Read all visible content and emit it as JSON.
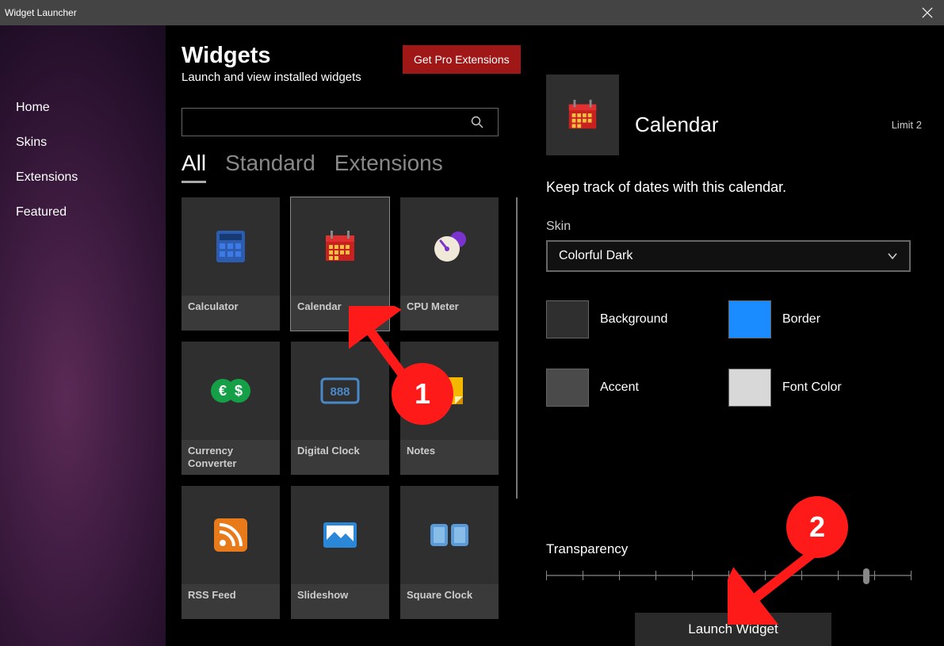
{
  "window": {
    "title": "Widget Launcher"
  },
  "sidebar": {
    "items": [
      "Home",
      "Skins",
      "Extensions",
      "Featured"
    ]
  },
  "header": {
    "title": "Widgets",
    "subtitle": "Launch and view installed widgets",
    "pro_button": "Get Pro Extensions"
  },
  "tabs": {
    "all": "All",
    "standard": "Standard",
    "extensions": "Extensions"
  },
  "widgets": [
    {
      "label": "Calculator",
      "icon": "calculator-icon"
    },
    {
      "label": "Calendar",
      "icon": "calendar-icon",
      "selected": true
    },
    {
      "label": "CPU Meter",
      "icon": "cpu-meter-icon"
    },
    {
      "label": "Currency Converter",
      "icon": "currency-icon"
    },
    {
      "label": "Digital Clock",
      "icon": "digital-clock-icon"
    },
    {
      "label": "Notes",
      "icon": "notes-icon"
    },
    {
      "label": "RSS Feed",
      "icon": "rss-icon"
    },
    {
      "label": "Slideshow",
      "icon": "slideshow-icon"
    },
    {
      "label": "Square Clock",
      "icon": "square-clock-icon"
    }
  ],
  "detail": {
    "title": "Calendar",
    "limit": "Limit 2",
    "description": "Keep track of dates with this calendar.",
    "skin_label": "Skin",
    "skin_value": "Colorful Dark",
    "colors": {
      "background": {
        "label": "Background",
        "hex": "#2f2f2f"
      },
      "border": {
        "label": "Border",
        "hex": "#1a8cff"
      },
      "accent": {
        "label": "Accent",
        "hex": "#4a4a4a"
      },
      "font": {
        "label": "Font Color",
        "hex": "#d8d8d8"
      }
    },
    "transparency_label": "Transparency",
    "transparency_value": 87,
    "launch_button": "Launch Widget"
  },
  "annotations": {
    "step1": "1",
    "step2": "2"
  }
}
